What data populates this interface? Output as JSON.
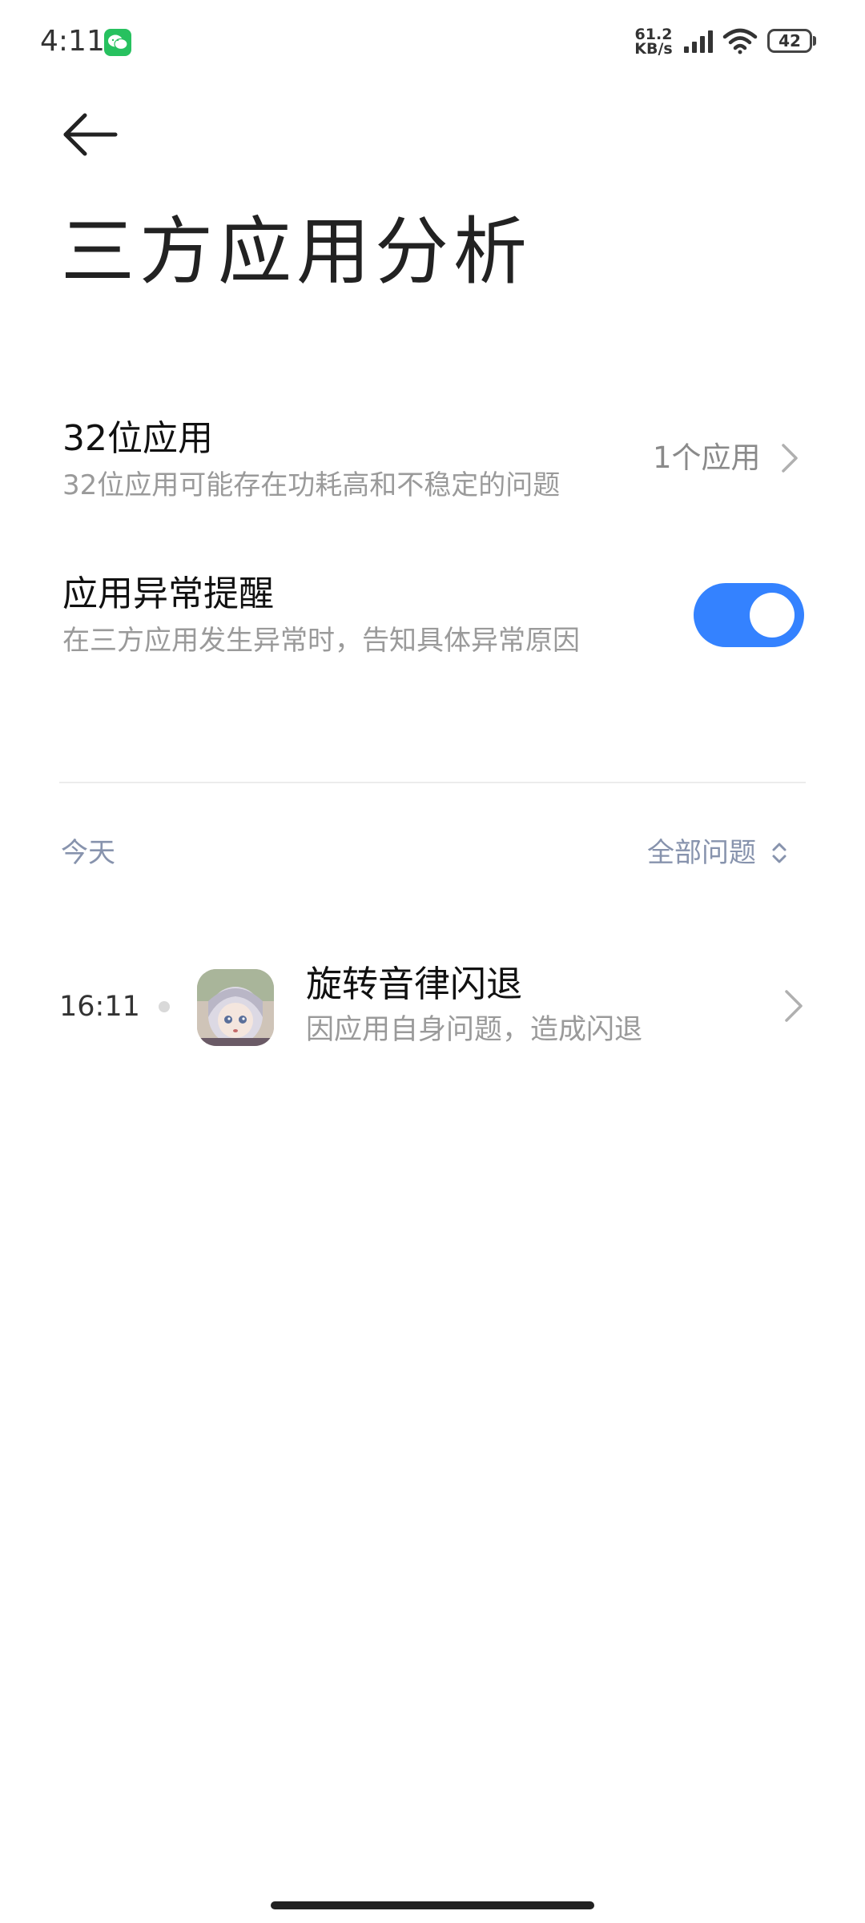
{
  "status_bar": {
    "time": "4:11",
    "net_speed_value": "61.2",
    "net_speed_unit": "KB/s",
    "battery": "42",
    "icons": [
      "wechat-icon",
      "signal-icon",
      "wifi-icon",
      "battery-icon"
    ]
  },
  "header": {
    "title": "三方应用分析"
  },
  "settings": {
    "app32": {
      "title": "32位应用",
      "subtitle": "32位应用可能存在功耗高和不稳定的问题",
      "value": "1个应用"
    },
    "alert": {
      "title": "应用异常提醒",
      "subtitle": "在三方应用发生异常时，告知具体异常原因",
      "enabled": true
    }
  },
  "log": {
    "date_label": "今天",
    "filter_label": "全部问题",
    "events": [
      {
        "time": "16:11",
        "app_name": "旋转音律闪退",
        "description": "因应用自身问题，造成闪退"
      }
    ]
  },
  "colors": {
    "accent": "#3482ff",
    "secondary_text": "#9a9a9a",
    "section_text": "#8793ad"
  }
}
